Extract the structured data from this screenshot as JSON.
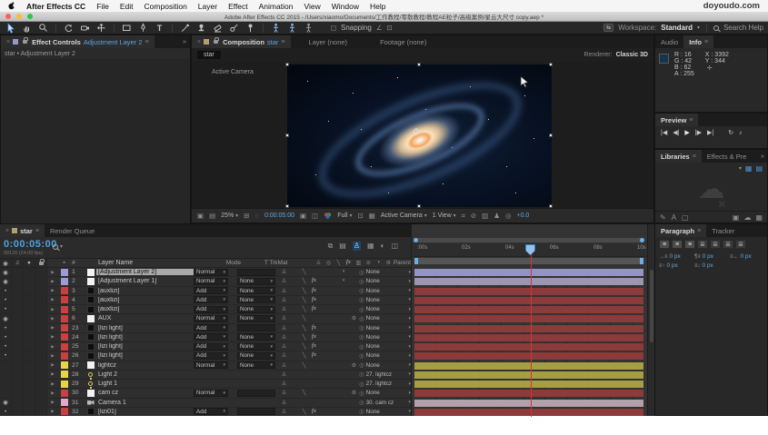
{
  "window": {
    "menu": {
      "items": [
        "After Effects CC",
        "File",
        "Edit",
        "Composition",
        "Layer",
        "Effect",
        "Animation",
        "View",
        "Window",
        "Help"
      ],
      "right_text": "doyoudo.com"
    },
    "title": "Adobe After Effects CC 2015 - /Users/xiaomo/Documents/工作教程/零散教程/教程AE粒子/高级案例/星云大尺寸 copy.aep *"
  },
  "toolbar": {
    "snapping_label": "Snapping",
    "workspace_label": "Workspace:",
    "workspace_value": "Standard",
    "search_label": "Search Help"
  },
  "effect_controls": {
    "title": "Effect Controls",
    "target": "Adjustment Layer 2",
    "breadcrumb": "star • Adjustment Layer 2"
  },
  "composition": {
    "tab_title": "Composition",
    "tab_target": "star",
    "tab_layer": "Layer (none)",
    "tab_footage": "Footage (none)",
    "renderer_label": "Renderer:",
    "renderer_value": "Classic 3D",
    "chip": "star",
    "camera_label": "Active Camera",
    "statusbar": {
      "zoom": "25%",
      "timecode": "0:00:05:00",
      "resolution": "Full",
      "view_mode": "Active Camera",
      "views": "1 View",
      "exposure": "+0.0"
    }
  },
  "info": {
    "tab_audio": "Audio",
    "tab_info": "Info",
    "rgba": [
      "R : 16",
      "G : 42",
      "B : 62",
      "A : 255"
    ],
    "xy": [
      "X : 3392",
      "Y : 344"
    ],
    "swatch_color": "#153450"
  },
  "preview": {
    "title": "Preview"
  },
  "libraries": {
    "tab": "Libraries",
    "tab2": "Effects & Pre"
  },
  "paragraph": {
    "tab": "Paragraph",
    "tab2": "Tracker",
    "fields": [
      {
        "name": "indent-left",
        "value": "0 px"
      },
      {
        "name": "indent-first-line",
        "value": "0 px"
      },
      {
        "name": "indent-right",
        "value": "0 px"
      },
      {
        "name": "space-before",
        "value": "0 px"
      },
      {
        "name": "space-after",
        "value": "0 px"
      }
    ]
  },
  "colors": {
    "accent_blue": "#58a7e4",
    "playhead_line": "#d23434",
    "label_lavender": "#9c9cd8",
    "label_red": "#c84040",
    "label_yellow": "#e8d44a",
    "label_pink": "#e8a8c8"
  },
  "timeline": {
    "tab": "star",
    "tab2": "Render Queue",
    "timecode": "0:00:05:00",
    "frames_info": "00120 (24.00 fps)",
    "columns": {
      "name": "Layer Name",
      "mode": "Mode",
      "trkmat": "T TrkMat",
      "parent": "Parent"
    },
    "ruler_ticks": [
      ":00s",
      "02s",
      "04s",
      "06s",
      "08s",
      "10s"
    ],
    "playhead_seconds": 5,
    "layers": [
      {
        "num": 1,
        "name": "[Adjustment Layer 2]",
        "mode": "Normal",
        "trkmat": "",
        "parent": "None",
        "label_color": "#9c9cd8",
        "swatch": "white",
        "av": "eye",
        "quality": true,
        "fx": false,
        "adjustment": true,
        "threed": false,
        "bar_color": "#9394c4",
        "selected": true
      },
      {
        "num": 2,
        "name": "[Adjustment Layer 1]",
        "mode": "Normal",
        "trkmat": "None",
        "parent": "None",
        "label_color": "#9c9cd8",
        "swatch": "white",
        "av": "eye",
        "quality": true,
        "fx": true,
        "adjustment": true,
        "threed": false,
        "bar_color": "#9c96b2",
        "selected": false
      },
      {
        "num": 3,
        "name": "[auxlizi]",
        "mode": "Add",
        "trkmat": "None",
        "parent": "None",
        "label_color": "#c84040",
        "swatch": "black",
        "av": "dot",
        "quality": true,
        "fx": true,
        "adjustment": false,
        "threed": false,
        "bar_color": "#8c3a3a",
        "selected": false
      },
      {
        "num": 4,
        "name": "[auxlizi]",
        "mode": "Add",
        "trkmat": "None",
        "parent": "None",
        "label_color": "#c84040",
        "swatch": "black",
        "av": "dot",
        "quality": true,
        "fx": true,
        "adjustment": false,
        "threed": false,
        "bar_color": "#8c3a3a",
        "selected": false
      },
      {
        "num": 5,
        "name": "[auxlizi]",
        "mode": "Add",
        "trkmat": "None",
        "parent": "None",
        "label_color": "#c84040",
        "swatch": "black",
        "av": "dot",
        "quality": true,
        "fx": true,
        "adjustment": false,
        "threed": false,
        "bar_color": "#8c3a3a",
        "selected": false
      },
      {
        "num": 6,
        "name": "AUX",
        "mode": "Normal",
        "trkmat": "None",
        "parent": "None",
        "label_color": "#c84040",
        "swatch": "white",
        "av": "eye",
        "quality": true,
        "fx": false,
        "adjustment": false,
        "threed": true,
        "bar_color": "#8c3a3a",
        "selected": false
      },
      {
        "num": 23,
        "name": "[lizi light]",
        "mode": "Add",
        "trkmat": "",
        "parent": "None",
        "label_color": "#c84040",
        "swatch": "black",
        "av": "dot",
        "quality": true,
        "fx": true,
        "adjustment": false,
        "threed": false,
        "bar_color": "#8c3a3a",
        "selected": false
      },
      {
        "num": 24,
        "name": "[lizi light]",
        "mode": "Add",
        "trkmat": "None",
        "parent": "None",
        "label_color": "#c84040",
        "swatch": "black",
        "av": "dot",
        "quality": true,
        "fx": true,
        "adjustment": false,
        "threed": false,
        "bar_color": "#8c3a3a",
        "selected": false
      },
      {
        "num": 25,
        "name": "[lizi light]",
        "mode": "Add",
        "trkmat": "None",
        "parent": "None",
        "label_color": "#c84040",
        "swatch": "black",
        "av": "dot",
        "quality": true,
        "fx": true,
        "adjustment": false,
        "threed": false,
        "bar_color": "#8c3a3a",
        "selected": false
      },
      {
        "num": 26,
        "name": "[lizi light]",
        "mode": "Add",
        "trkmat": "None",
        "parent": "None",
        "label_color": "#c84040",
        "swatch": "black",
        "av": "dot",
        "quality": true,
        "fx": true,
        "adjustment": false,
        "threed": false,
        "bar_color": "#8c3a3a",
        "selected": false
      },
      {
        "num": 27,
        "name": "lightcz",
        "mode": "Normal",
        "trkmat": "None",
        "parent": "None",
        "label_color": "#e8d44a",
        "swatch": "white",
        "av": "",
        "quality": true,
        "fx": false,
        "adjustment": false,
        "threed": true,
        "bar_color": "#a69e44",
        "selected": false
      },
      {
        "num": 28,
        "name": "Light 2",
        "mode": null,
        "trkmat": null,
        "parent": "27. lightcz",
        "label_color": "#e8d44a",
        "swatch": "bulb",
        "av": "",
        "quality": false,
        "fx": false,
        "adjustment": false,
        "threed": false,
        "bar_color": "#a69e44",
        "selected": false
      },
      {
        "num": 29,
        "name": "Light 1",
        "mode": null,
        "trkmat": null,
        "parent": "27. lightcz",
        "label_color": "#e8d44a",
        "swatch": "bulb",
        "av": "",
        "quality": false,
        "fx": false,
        "adjustment": false,
        "threed": false,
        "bar_color": "#a69e44",
        "selected": false
      },
      {
        "num": 30,
        "name": "cam cz",
        "mode": "Normal",
        "trkmat": "",
        "parent": "None",
        "label_color": "#c84040",
        "swatch": "white",
        "av": "",
        "quality": true,
        "fx": false,
        "adjustment": false,
        "threed": true,
        "bar_color": "#8c3a3a",
        "selected": false
      },
      {
        "num": 31,
        "name": "Camera 1",
        "mode": null,
        "trkmat": null,
        "parent": "30. cam cz",
        "label_color": "#e8a8c8",
        "swatch": "camera",
        "av": "eye",
        "quality": false,
        "fx": false,
        "adjustment": false,
        "threed": false,
        "bar_color": "#b2a0aa",
        "selected": false
      },
      {
        "num": 32,
        "name": "[lizi01]",
        "mode": "Add",
        "trkmat": "",
        "parent": "None",
        "label_color": "#c84040",
        "swatch": "black",
        "av": "dot",
        "quality": true,
        "fx": true,
        "adjustment": false,
        "threed": false,
        "bar_color": "#8c3a3a",
        "selected": false
      }
    ]
  }
}
